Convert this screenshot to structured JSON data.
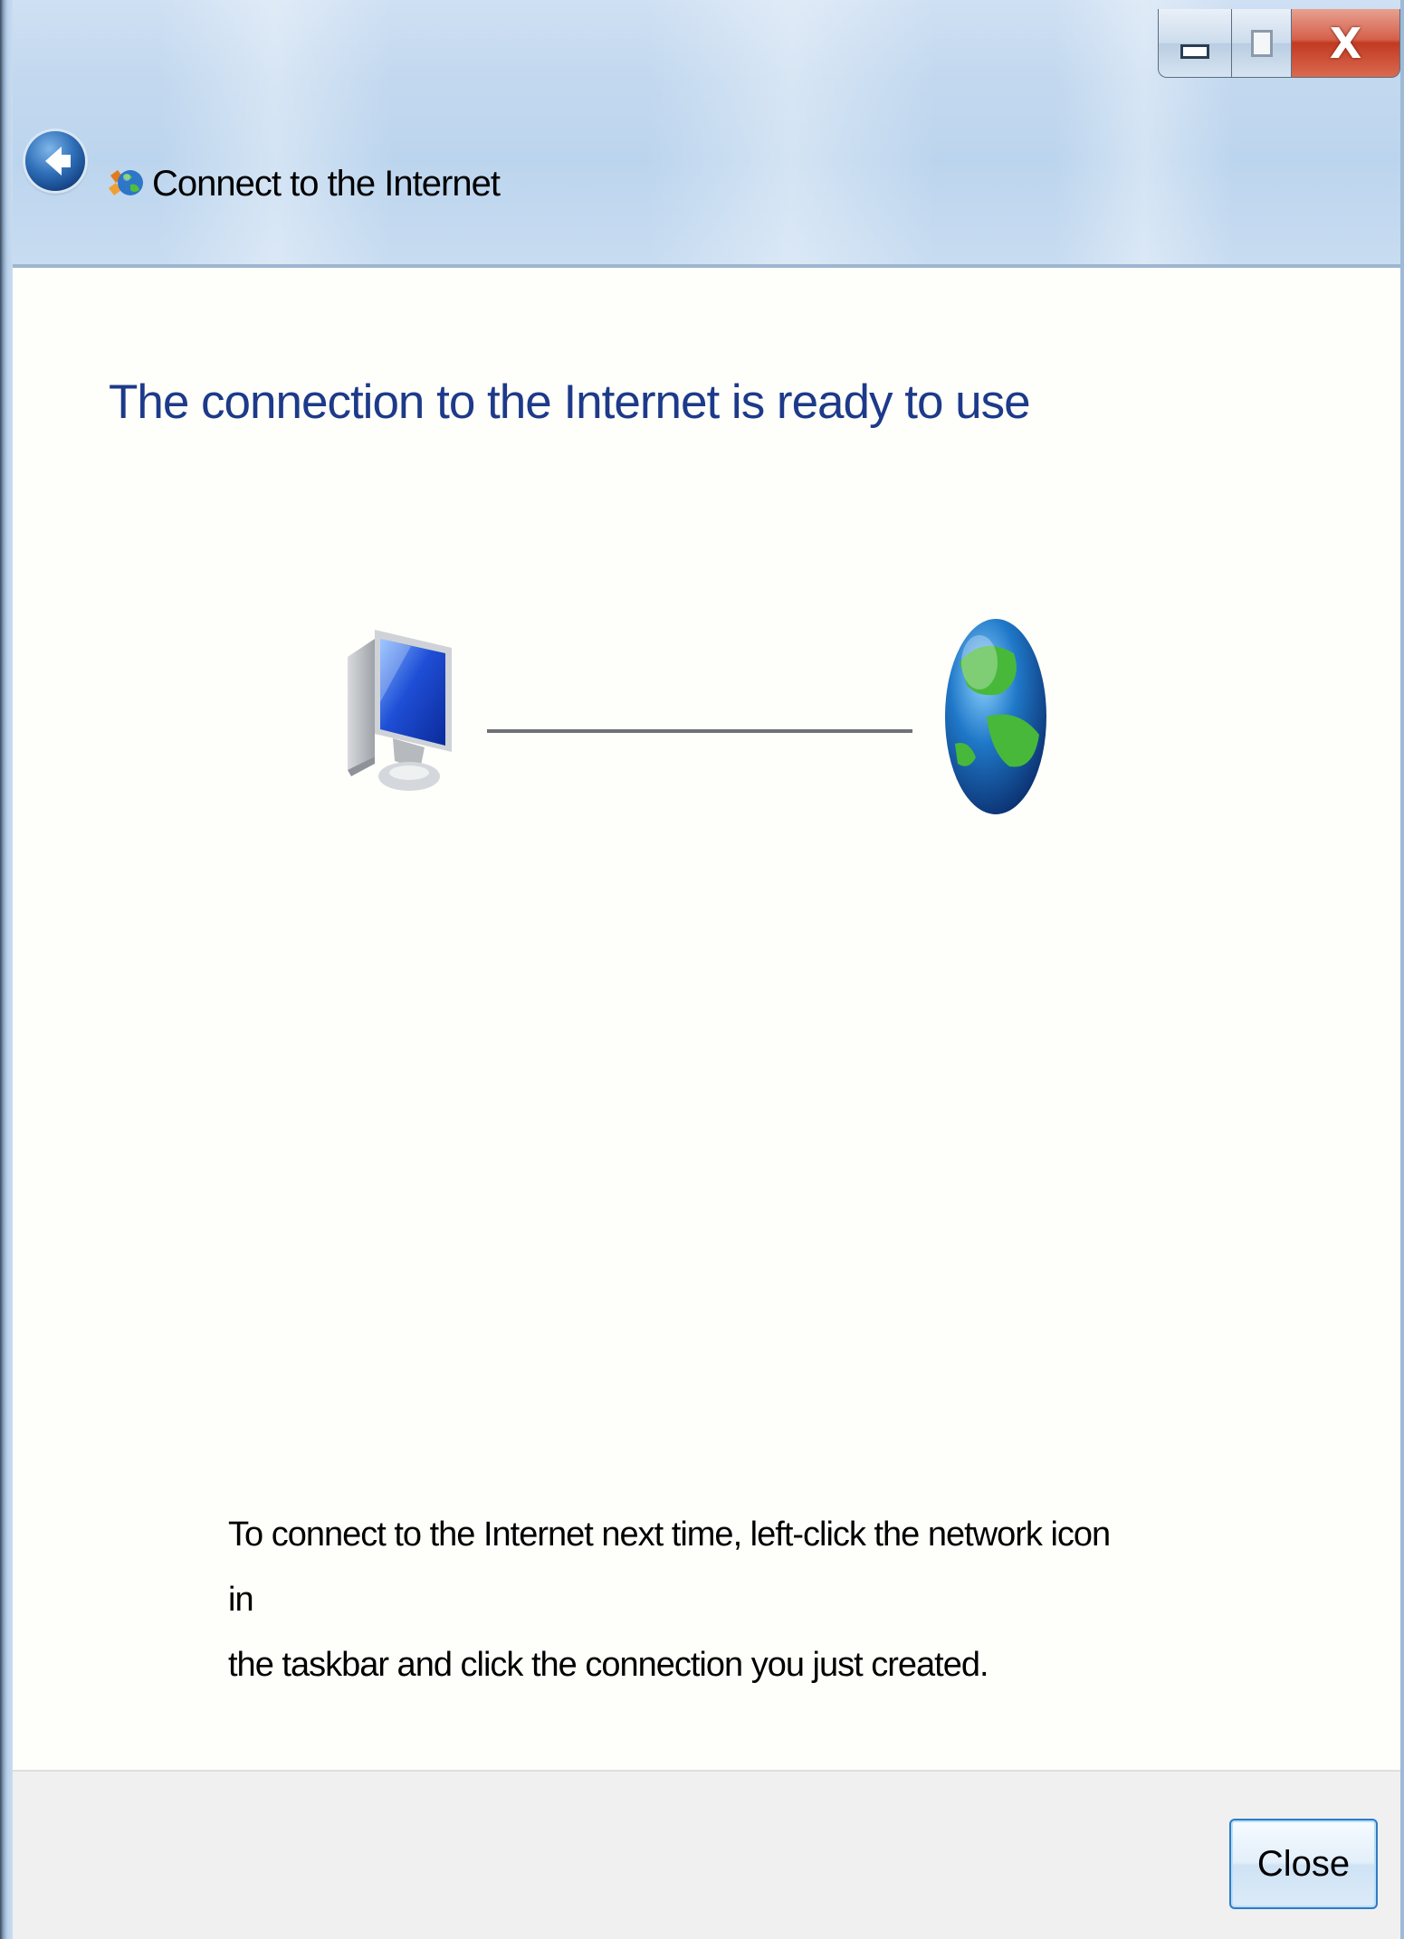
{
  "window": {
    "title": "Connect to the Internet",
    "caption_buttons": {
      "minimize_icon": "minimize-icon",
      "maximize_icon": "maximize-icon",
      "close_glyph": "X"
    },
    "back_icon": "back-arrow-icon",
    "app_icon": "network-globe-icon"
  },
  "content": {
    "heading": "The connection to the Internet is ready to use",
    "diagram": {
      "left_icon": "computer-icon",
      "right_icon": "globe-icon"
    },
    "info_line_1": "To connect to the Internet next time, left-click the network icon in",
    "info_line_2": "the taskbar and click the connection you just created."
  },
  "footer": {
    "close_label": "Close"
  },
  "colors": {
    "heading": "#1d3a8a",
    "titlebar": "#c2d8ef",
    "content_bg": "#fefefa",
    "footer_bg": "#f0f0f0",
    "close_caption": "#c23a22"
  }
}
